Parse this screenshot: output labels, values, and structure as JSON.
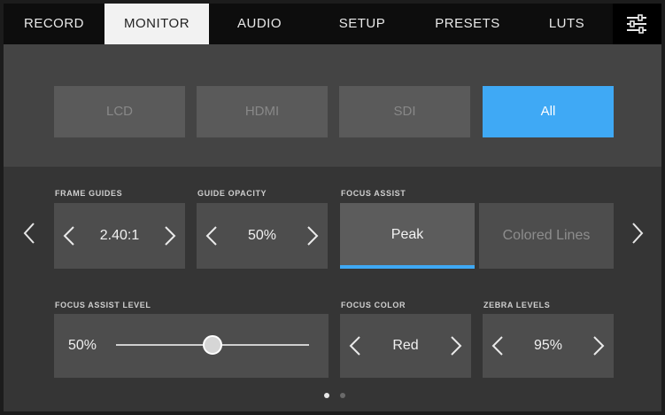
{
  "tabs": [
    {
      "label": "RECORD",
      "active": false
    },
    {
      "label": "MONITOR",
      "active": true
    },
    {
      "label": "AUDIO",
      "active": false
    },
    {
      "label": "SETUP",
      "active": false
    },
    {
      "label": "PRESETS",
      "active": false
    },
    {
      "label": "LUTS",
      "active": false
    }
  ],
  "settings_tab_icon": "sliders-icon",
  "monitor_selector": {
    "options": [
      "LCD",
      "HDMI",
      "SDI",
      "All"
    ],
    "selected": "All"
  },
  "frame_guides": {
    "label": "FRAME GUIDES",
    "value": "2.40:1"
  },
  "guide_opacity": {
    "label": "GUIDE OPACITY",
    "value": "50%"
  },
  "focus_assist": {
    "label": "FOCUS ASSIST",
    "options": [
      "Peak",
      "Colored Lines"
    ],
    "selected": "Peak"
  },
  "focus_assist_level": {
    "label": "FOCUS ASSIST LEVEL",
    "value": "50%",
    "level_percent": 50
  },
  "focus_color": {
    "label": "FOCUS COLOR",
    "value": "Red"
  },
  "zebra_levels": {
    "label": "ZEBRA LEVELS",
    "value": "95%"
  },
  "pagination": {
    "pages": 2,
    "current": 1
  },
  "colors": {
    "accent": "#3fa9f5",
    "tab_bar": "#0d0d0d",
    "active_tab": "#f2f2f2",
    "panel": "#353535",
    "control": "#4d4d4d"
  }
}
